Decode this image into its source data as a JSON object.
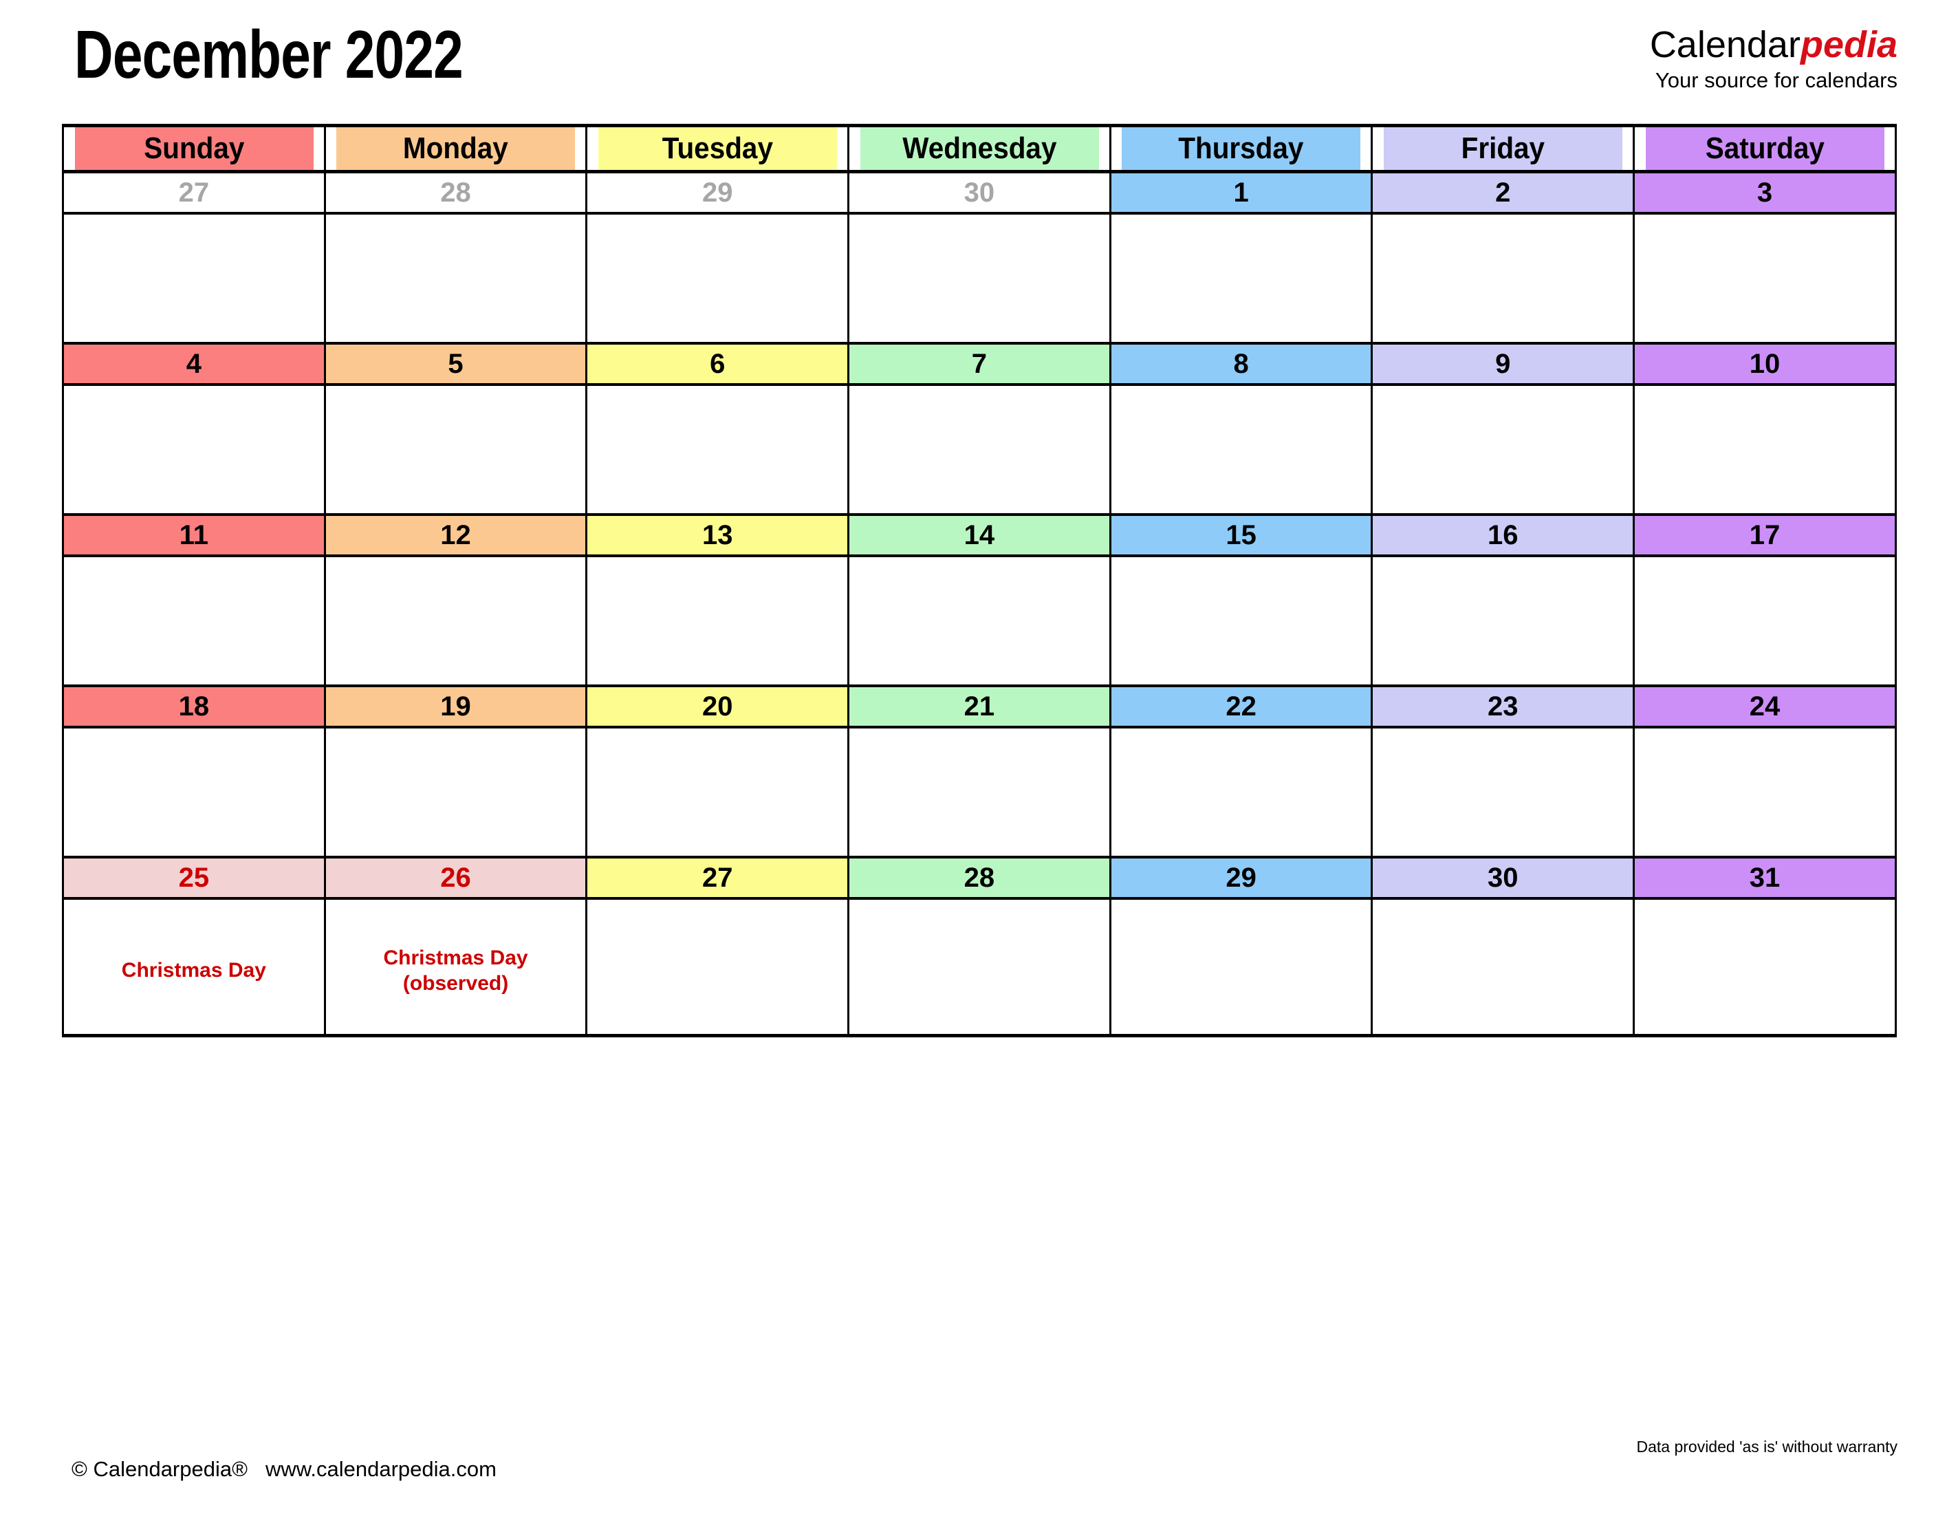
{
  "header": {
    "title": "December 2022",
    "brand_part1": "Calendar",
    "brand_part2": "pedia",
    "brand_tagline": "Your source for calendars"
  },
  "weekdays": [
    {
      "label": "Sunday",
      "color": "#fb7f7f"
    },
    {
      "label": "Monday",
      "color": "#fcc891"
    },
    {
      "label": "Tuesday",
      "color": "#fdfd8f"
    },
    {
      "label": "Wednesday",
      "color": "#b9f7c2"
    },
    {
      "label": "Thursday",
      "color": "#8ecbf8"
    },
    {
      "label": "Friday",
      "color": "#ccccf7"
    },
    {
      "label": "Saturday",
      "color": "#cc8ff7"
    }
  ],
  "colors": {
    "holiday_band": "#f2d2d2",
    "holiday_text": "#cc0000",
    "outside_text": "#a6a6a6",
    "brand_red": "#d90d18",
    "grid_line": "#000000"
  },
  "weeks": [
    {
      "days": [
        {
          "num": "27",
          "outside": true,
          "holiday": false,
          "event": ""
        },
        {
          "num": "28",
          "outside": true,
          "holiday": false,
          "event": ""
        },
        {
          "num": "29",
          "outside": true,
          "holiday": false,
          "event": ""
        },
        {
          "num": "30",
          "outside": true,
          "holiday": false,
          "event": ""
        },
        {
          "num": "1",
          "outside": false,
          "holiday": false,
          "event": ""
        },
        {
          "num": "2",
          "outside": false,
          "holiday": false,
          "event": ""
        },
        {
          "num": "3",
          "outside": false,
          "holiday": false,
          "event": ""
        }
      ]
    },
    {
      "days": [
        {
          "num": "4",
          "outside": false,
          "holiday": false,
          "event": ""
        },
        {
          "num": "5",
          "outside": false,
          "holiday": false,
          "event": ""
        },
        {
          "num": "6",
          "outside": false,
          "holiday": false,
          "event": ""
        },
        {
          "num": "7",
          "outside": false,
          "holiday": false,
          "event": ""
        },
        {
          "num": "8",
          "outside": false,
          "holiday": false,
          "event": ""
        },
        {
          "num": "9",
          "outside": false,
          "holiday": false,
          "event": ""
        },
        {
          "num": "10",
          "outside": false,
          "holiday": false,
          "event": ""
        }
      ]
    },
    {
      "days": [
        {
          "num": "11",
          "outside": false,
          "holiday": false,
          "event": ""
        },
        {
          "num": "12",
          "outside": false,
          "holiday": false,
          "event": ""
        },
        {
          "num": "13",
          "outside": false,
          "holiday": false,
          "event": ""
        },
        {
          "num": "14",
          "outside": false,
          "holiday": false,
          "event": ""
        },
        {
          "num": "15",
          "outside": false,
          "holiday": false,
          "event": ""
        },
        {
          "num": "16",
          "outside": false,
          "holiday": false,
          "event": ""
        },
        {
          "num": "17",
          "outside": false,
          "holiday": false,
          "event": ""
        }
      ]
    },
    {
      "days": [
        {
          "num": "18",
          "outside": false,
          "holiday": false,
          "event": ""
        },
        {
          "num": "19",
          "outside": false,
          "holiday": false,
          "event": ""
        },
        {
          "num": "20",
          "outside": false,
          "holiday": false,
          "event": ""
        },
        {
          "num": "21",
          "outside": false,
          "holiday": false,
          "event": ""
        },
        {
          "num": "22",
          "outside": false,
          "holiday": false,
          "event": ""
        },
        {
          "num": "23",
          "outside": false,
          "holiday": false,
          "event": ""
        },
        {
          "num": "24",
          "outside": false,
          "holiday": false,
          "event": ""
        }
      ]
    },
    {
      "days": [
        {
          "num": "25",
          "outside": false,
          "holiday": true,
          "event": "Christmas Day"
        },
        {
          "num": "26",
          "outside": false,
          "holiday": true,
          "event": "Christmas Day (observed)"
        },
        {
          "num": "27",
          "outside": false,
          "holiday": false,
          "event": ""
        },
        {
          "num": "28",
          "outside": false,
          "holiday": false,
          "event": ""
        },
        {
          "num": "29",
          "outside": false,
          "holiday": false,
          "event": ""
        },
        {
          "num": "30",
          "outside": false,
          "holiday": false,
          "event": ""
        },
        {
          "num": "31",
          "outside": false,
          "holiday": false,
          "event": ""
        }
      ]
    }
  ],
  "footer": {
    "copyright": "© Calendarpedia®",
    "website": "www.calendarpedia.com",
    "disclaimer": "Data provided 'as is' without warranty"
  }
}
